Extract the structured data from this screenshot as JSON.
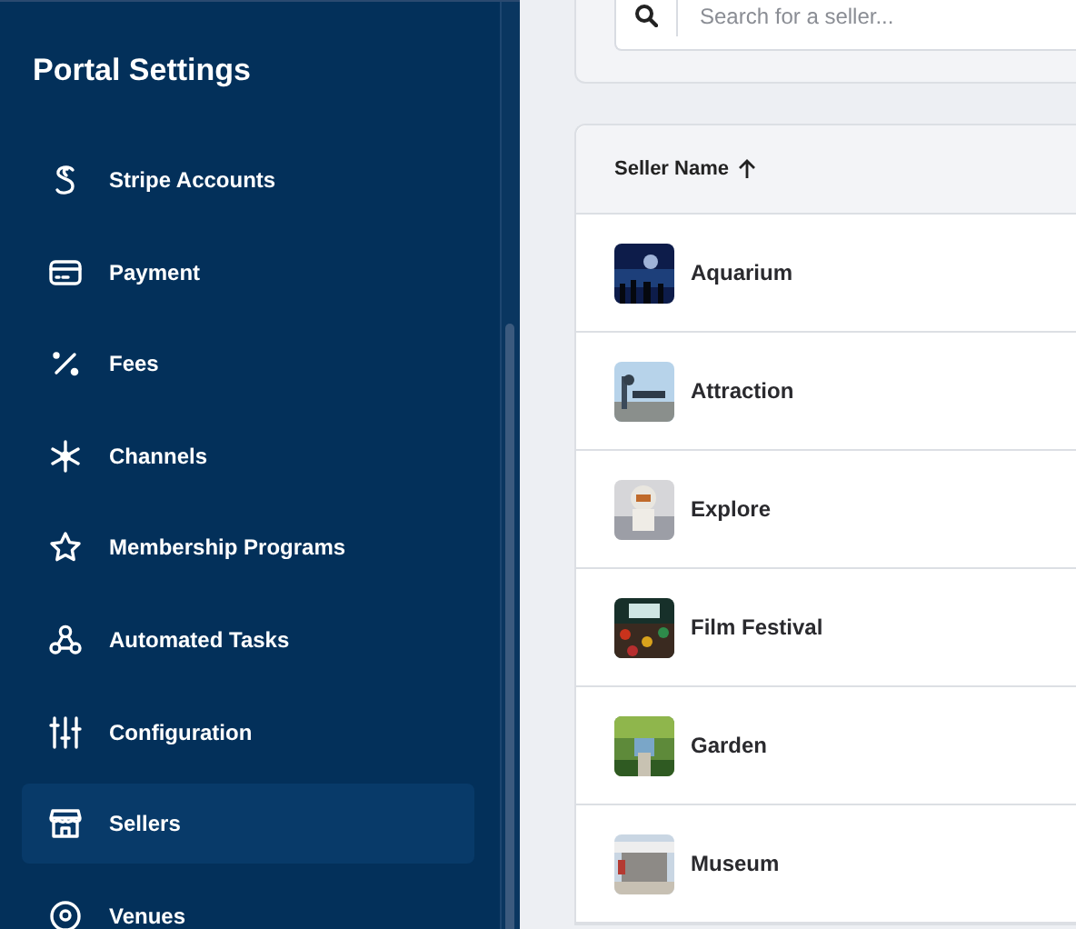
{
  "sidebar": {
    "title": "Portal Settings",
    "items": [
      {
        "label": "Stripe Accounts",
        "selected": false
      },
      {
        "label": "Payment",
        "selected": false
      },
      {
        "label": "Fees",
        "selected": false
      },
      {
        "label": "Channels",
        "selected": false
      },
      {
        "label": "Membership Programs",
        "selected": false
      },
      {
        "label": "Automated Tasks",
        "selected": false
      },
      {
        "label": "Configuration",
        "selected": false
      },
      {
        "label": "Sellers",
        "selected": true
      },
      {
        "label": "Venues",
        "selected": false
      }
    ]
  },
  "search": {
    "placeholder": "Search for a seller..."
  },
  "table": {
    "columns": [
      {
        "label": "Seller Name",
        "sort_ascending": true
      }
    ],
    "rows": [
      {
        "name": "Aquarium"
      },
      {
        "name": "Attraction"
      },
      {
        "name": "Explore"
      },
      {
        "name": "Film Festival"
      },
      {
        "name": "Garden"
      },
      {
        "name": "Museum"
      }
    ]
  }
}
